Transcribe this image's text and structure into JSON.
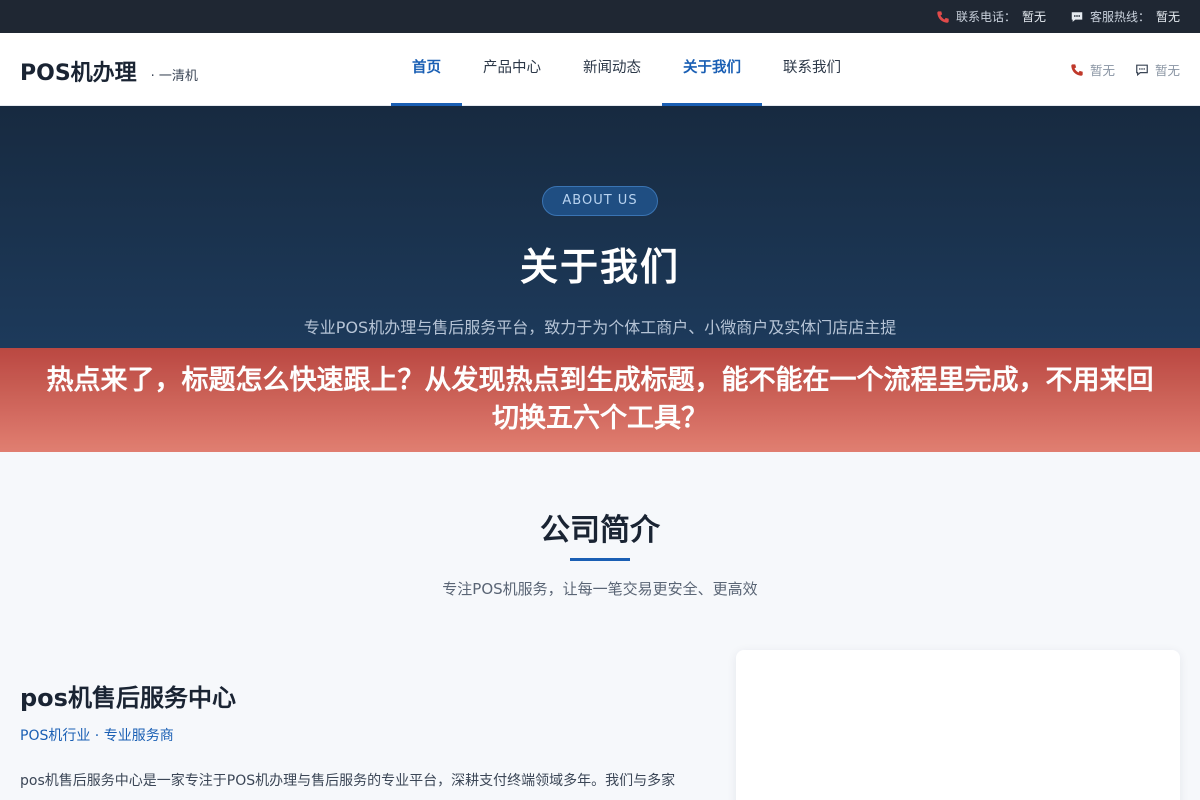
{
  "topbar": {
    "phone_label": "联系电话：",
    "phone_value": "暂无",
    "service_label": "客服热线：",
    "service_value": "暂无"
  },
  "header": {
    "logo": "POS机办理",
    "logo_sub": "· 一清机",
    "nav": [
      "首页",
      "产品中心",
      "新闻动态",
      "关于我们",
      "联系我们"
    ],
    "phone_value": "暂无",
    "chat_value": "暂无"
  },
  "hero": {
    "badge": "ABOUT US",
    "title": "关于我们",
    "description": "专业POS机办理与售后服务平台，致力于为个体工商户、小微商户及实体门店店主提供安全、便捷、高效的支付终端解决方案。"
  },
  "banner": {
    "text": "热点来了，标题怎么快速跟上？从发现热点到生成标题，能不能在一个流程里完成，不用来回切换五六个工具？"
  },
  "section": {
    "title": "公司简介",
    "subtitle": "专注POS机服务，让每一笔交易更安全、更高效"
  },
  "intro": {
    "title": "pos机售后服务中心",
    "tag": "POS机行业 · 专业服务商",
    "text": "pos机售后服务中心是一家专注于POS机办理与售后服务的专业平台，深耕支付终端领域多年。我们与多家持有央行支付牌照的正规支付机构建立深度合作，严格筛选一清POS机产品，确保每一台终端"
  },
  "colors": {
    "accent": "#1a5fb4",
    "topbar_bg": "#1f2733",
    "hero_bg": "#1d3a5b",
    "banner_top": "#b8413a",
    "banner_bottom": "#e07a6c"
  }
}
